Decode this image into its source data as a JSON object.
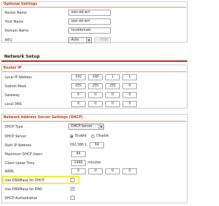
{
  "optional_settings": {
    "legend": "Optional Settings",
    "router_name": {
      "label": "Router Name",
      "value": "wan-dd-wrt"
    },
    "host_name": {
      "label": "Host Name",
      "value": "wan-dd-wrt"
    },
    "domain_name": {
      "label": "Domain Name",
      "value": "localdomain"
    },
    "mtu": {
      "label": "MTU",
      "mode": "Auto",
      "value": "1500"
    }
  },
  "network_setup": {
    "title": "Network Setup"
  },
  "router_ip": {
    "legend": "Router IP",
    "local_ip": {
      "label": "Local IP Address",
      "octets": [
        "192",
        "168",
        "1",
        "1"
      ]
    },
    "subnet_mask": {
      "label": "Subnet Mask",
      "octets": [
        "255",
        "255",
        "255",
        "0"
      ]
    },
    "gateway": {
      "label": "Gateway",
      "octets": [
        "0",
        "0",
        "0",
        "0"
      ]
    },
    "local_dns": {
      "label": "Local DNS",
      "octets": [
        "0",
        "0",
        "0",
        "0"
      ]
    }
  },
  "dhcp": {
    "legend": "Network Address Server Settings (DHCP)",
    "dhcp_type": {
      "label": "DHCP Type",
      "value": "DHCP Server"
    },
    "dhcp_server": {
      "label": "DHCP Server",
      "enable": "Enable",
      "disable": "Disable",
      "selected": "Enable"
    },
    "start_ip": {
      "label": "Start IP Address",
      "prefix": "192.168.1.",
      "value": "64"
    },
    "max_users": {
      "label": "Maximum DHCP Users",
      "value": "64"
    },
    "lease_time": {
      "label": "Client Lease Time",
      "value": "1440",
      "unit": "minutes"
    },
    "wins": {
      "label": "WINS",
      "octets": [
        "0",
        "0",
        "0",
        "0"
      ]
    },
    "dnsmasq_dhcp": {
      "label": "Use DNSMasq for DHCP",
      "checked": false
    },
    "dnsmasq_dns": {
      "label": "Use DNSMasq for DNS",
      "checked": true
    },
    "dhcp_authoritative": {
      "label": "DHCP-Authoritative",
      "checked": false
    }
  },
  "colors": {
    "legend_red": "#c33000",
    "section_rule": "#b80e00",
    "highlight": "#f2ec2c"
  }
}
